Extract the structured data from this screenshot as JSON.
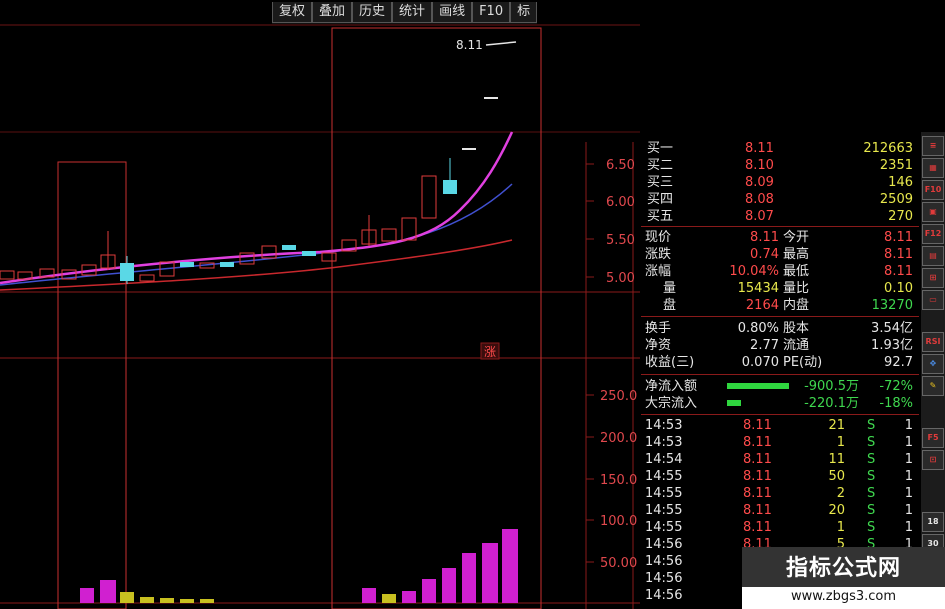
{
  "toolbar": {
    "buttons": [
      "复权",
      "叠加",
      "历史",
      "统计",
      "画线",
      "F10",
      "标"
    ]
  },
  "price_chart": {
    "y_labels": [
      "6.50",
      "6.00",
      "5.50",
      "5.00"
    ],
    "last_price_label": "8.11",
    "limit_marker": "涨"
  },
  "volume_chart": {
    "y_labels": [
      "250.0",
      "200.0",
      "150.0",
      "100.0",
      "50.00"
    ]
  },
  "chart_data": {
    "type": "candlestick",
    "y_labels": [
      "6.50",
      "6.00",
      "5.50",
      "5.00"
    ],
    "volume_labels": [
      "250.0",
      "200.0",
      "150.0",
      "100.0",
      "50.00"
    ]
  },
  "order_book": {
    "bids": [
      {
        "label": "买一",
        "price": "8.11",
        "vol": "212663"
      },
      {
        "label": "买二",
        "price": "8.10",
        "vol": "2351"
      },
      {
        "label": "买三",
        "price": "8.09",
        "vol": "146"
      },
      {
        "label": "买四",
        "price": "8.08",
        "vol": "2509"
      },
      {
        "label": "买五",
        "price": "8.07",
        "vol": "270"
      }
    ]
  },
  "stats": [
    {
      "l1": "现价",
      "v1": "8.11",
      "l2": "今开",
      "v2": "8.11"
    },
    {
      "l1": "涨跌",
      "v1": "0.74",
      "l2": "最高",
      "v2": "8.11"
    },
    {
      "l1": "涨幅",
      "v1": "10.04%",
      "l2": "最低",
      "v2": "8.11"
    },
    {
      "l1": "量",
      "v1": "15434",
      "l2": "量比",
      "v2": "0.10"
    },
    {
      "l1": "盘",
      "v1": "2164",
      "l2": "内盘",
      "v2": "13270"
    }
  ],
  "fundamentals": [
    {
      "l1": "换手",
      "v1": "0.80%",
      "l2": "股本",
      "v2": "3.54亿"
    },
    {
      "l1": "净资",
      "v1": "2.77",
      "l2": "流通",
      "v2": "1.93亿"
    },
    {
      "l1": "收益(三)",
      "v1": "0.070",
      "l2": "PE(动)",
      "v2": "92.7"
    }
  ],
  "flows": [
    {
      "label": "净流入额",
      "value": "-900.5万",
      "pct": "-72%"
    },
    {
      "label": "大宗流入",
      "value": "-220.1万",
      "pct": "-18%"
    }
  ],
  "ticks": [
    {
      "time": "14:53",
      "price": "8.11",
      "vol": "21",
      "side": "S",
      "n": "1"
    },
    {
      "time": "14:53",
      "price": "8.11",
      "vol": "1",
      "side": "S",
      "n": "1"
    },
    {
      "time": "14:54",
      "price": "8.11",
      "vol": "11",
      "side": "S",
      "n": "1"
    },
    {
      "time": "14:55",
      "price": "8.11",
      "vol": "50",
      "side": "S",
      "n": "1"
    },
    {
      "time": "14:55",
      "price": "8.11",
      "vol": "2",
      "side": "S",
      "n": "1"
    },
    {
      "time": "14:55",
      "price": "8.11",
      "vol": "20",
      "side": "S",
      "n": "1"
    },
    {
      "time": "14:55",
      "price": "8.11",
      "vol": "1",
      "side": "S",
      "n": "1"
    },
    {
      "time": "14:56",
      "price": "8.11",
      "vol": "5",
      "side": "S",
      "n": "1"
    },
    {
      "time": "14:56",
      "price": "",
      "vol": "",
      "side": "",
      "n": ""
    },
    {
      "time": "14:56",
      "price": "",
      "vol": "",
      "side": "",
      "n": ""
    },
    {
      "time": "14:56",
      "price": "",
      "vol": "",
      "side": "",
      "n": ""
    }
  ],
  "sidebar": {
    "buttons": [
      "≡",
      "▦",
      "F10",
      "▣",
      "F12",
      "▤",
      "⊞",
      "▭",
      "RSI",
      "✥",
      "✎",
      "F5",
      "⊡",
      "18",
      "30"
    ]
  },
  "watermark": {
    "title": "指标公式网",
    "url": "www.zbgs3.com"
  }
}
